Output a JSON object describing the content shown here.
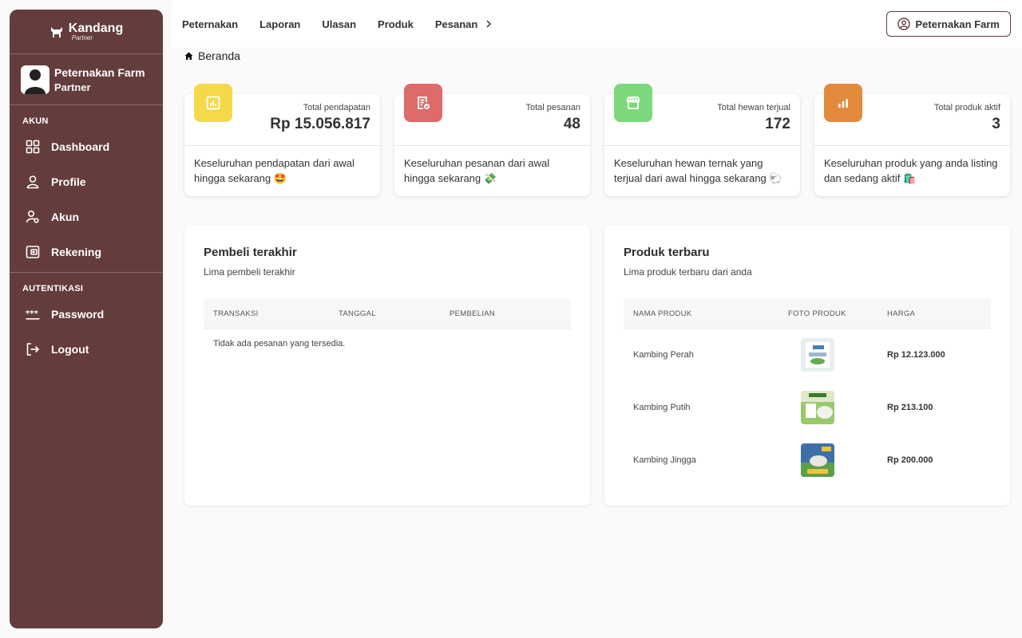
{
  "sidebar": {
    "brand": {
      "name": "Kandang",
      "sub": "Partner"
    },
    "user": {
      "name": "Peternakan Farm",
      "role": "Partner"
    },
    "sections": [
      {
        "title": "AKUN",
        "items": [
          {
            "label": "Dashboard",
            "icon": "grid-icon"
          },
          {
            "label": "Profile",
            "icon": "user-icon"
          },
          {
            "label": "Akun",
            "icon": "user-gear-icon"
          },
          {
            "label": "Rekening",
            "icon": "wallet-icon"
          }
        ]
      },
      {
        "title": "AUTENTIKASI",
        "items": [
          {
            "label": "Password",
            "icon": "password-icon"
          },
          {
            "label": "Logout",
            "icon": "logout-icon"
          }
        ]
      }
    ]
  },
  "topbar": {
    "nav": [
      "Peternakan",
      "Laporan",
      "Ulasan",
      "Produk",
      "Pesanan"
    ],
    "account_label": "Peternakan Farm"
  },
  "breadcrumb": {
    "label": "Beranda"
  },
  "stats": [
    {
      "label": "Total pendapatan",
      "value": "Rp 15.056.817",
      "desc": "Keseluruhan pendapatan dari awal hingga sekarang 🤩",
      "color": "#f5d94b",
      "icon": "chart-icon"
    },
    {
      "label": "Total pesanan",
      "value": "48",
      "desc": "Keseluruhan pesanan dari awal hingga sekarang 💸",
      "color": "#de6a6a",
      "icon": "order-check-icon"
    },
    {
      "label": "Total hewan terjual",
      "value": "172",
      "desc": "Keseluruhan hewan ternak yang terjual dari awal hingga sekarang 🐑",
      "color": "#7bd97b",
      "icon": "store-icon"
    },
    {
      "label": "Total produk aktif",
      "value": "3",
      "desc": "Keseluruhan produk yang anda listing dan sedang aktif 🛍️",
      "color": "#e48a3c",
      "icon": "bar-chart-icon"
    }
  ],
  "buyers": {
    "title": "Pembeli terakhir",
    "subtitle": "Lima pembeli terakhir",
    "columns": [
      "TRANSAKSI",
      "TANGGAL",
      "PEMBELIAN"
    ],
    "empty_message": "Tidak ada pesanan yang tersedia."
  },
  "products": {
    "title": "Produk terbaru",
    "subtitle": "Lima produk terbaru dari anda",
    "columns": [
      "NAMA PRODUK",
      "FOTO PRODUK",
      "HARGA"
    ],
    "rows": [
      {
        "name": "Kambing Perah",
        "price": "Rp 12.123.000"
      },
      {
        "name": "Kambing Putih",
        "price": "Rp 213.100"
      },
      {
        "name": "Kambing Jingga",
        "price": "Rp 200.000"
      }
    ]
  }
}
